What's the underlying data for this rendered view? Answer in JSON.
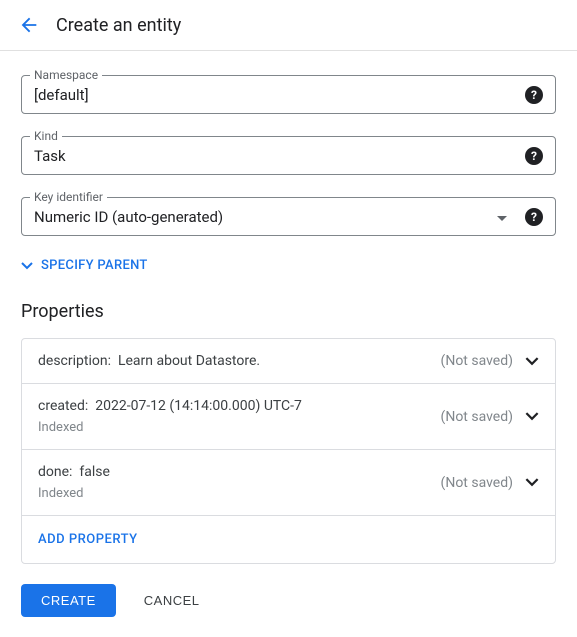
{
  "header": {
    "title": "Create an entity"
  },
  "fields": {
    "namespace": {
      "label": "Namespace",
      "value": "[default]"
    },
    "kind": {
      "label": "Kind",
      "value": "Task"
    },
    "keyIdentifier": {
      "label": "Key identifier",
      "value": "Numeric ID (auto-generated)"
    }
  },
  "specifyParent": "SPECIFY PARENT",
  "propertiesTitle": "Properties",
  "properties": [
    {
      "key": "description:",
      "value": "Learn about Datastore.",
      "indexed": "",
      "status": "(Not saved)"
    },
    {
      "key": "created:",
      "value": "2022-07-12 (14:14:00.000) UTC-7",
      "indexed": "Indexed",
      "status": "(Not saved)"
    },
    {
      "key": "done:",
      "value": "false",
      "indexed": "Indexed",
      "status": "(Not saved)"
    }
  ],
  "addProperty": "ADD PROPERTY",
  "actions": {
    "create": "CREATE",
    "cancel": "CANCEL"
  }
}
